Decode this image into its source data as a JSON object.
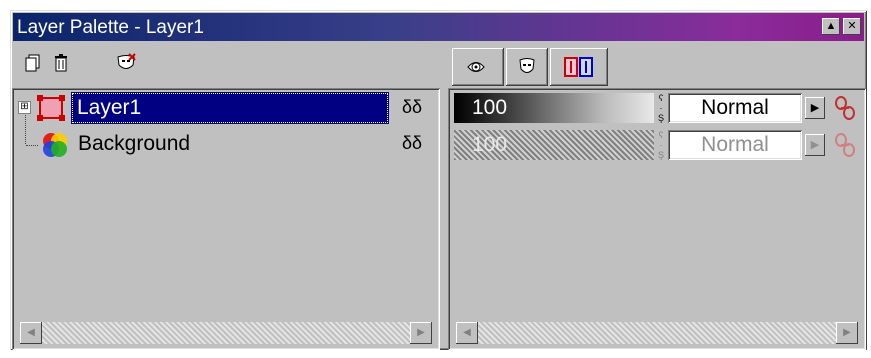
{
  "window": {
    "title": "Layer Palette - Layer1",
    "minimize_glyph": "▲",
    "close_glyph": "✕"
  },
  "toolbar": {
    "icons": [
      "new-layer-icon",
      "delete-layer-icon",
      "mask-icon"
    ]
  },
  "tabs": [
    "layer-properties-icon",
    "mask-tab-icon",
    "lock-tab-icon"
  ],
  "layers": [
    {
      "name": "Layer1",
      "selected": true,
      "expand_glyph": "⊞",
      "visibility_glyph": "δδ",
      "opacity": "100",
      "blend_mode": "Normal",
      "enabled": true
    },
    {
      "name": "Background",
      "selected": false,
      "visibility_glyph": "δδ",
      "opacity": "100",
      "blend_mode": "Normal",
      "enabled": false
    }
  ],
  "colors": {
    "selection": "#000080",
    "title_start": "#0a246a",
    "title_end": "#8a1c8c"
  }
}
